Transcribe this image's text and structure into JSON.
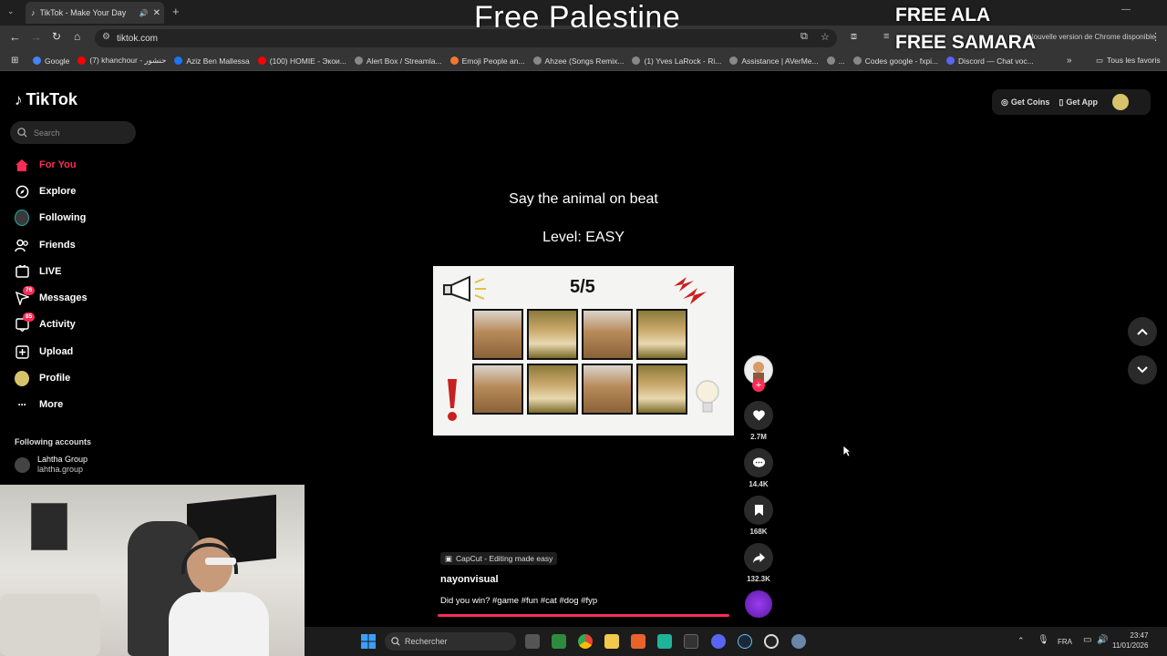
{
  "overlay": {
    "main": "Free Palestine",
    "line1": "FREE ALA",
    "line2": "FREE SAMARA"
  },
  "browser": {
    "tab_title": "TikTok - Make Your Day",
    "url": "tiktok.com",
    "update_notice": "Nouvelle version de Chrome disponible",
    "bookmarks": [
      {
        "label": "Google",
        "color": "#4285f4"
      },
      {
        "label": "(7) khanchour - حنشور",
        "color": "#ff0000"
      },
      {
        "label": "Aziz Ben Mallessa",
        "color": "#1877f2"
      },
      {
        "label": "(100) HOMIE - Экои...",
        "color": "#ff0000"
      },
      {
        "label": "Alert Box / Streamla...",
        "color": "#888888"
      },
      {
        "label": "Emoji People an...",
        "color": "#f27830"
      },
      {
        "label": "Ahzee (Songs Remix...",
        "color": "#888888"
      },
      {
        "label": "(1) Yves LaRock - Ri...",
        "color": "#888888"
      },
      {
        "label": "Assistance | AVerMe...",
        "color": "#888888"
      },
      {
        "label": "...",
        "color": "#888888"
      },
      {
        "label": "Codes google - fxpi...",
        "color": "#888888"
      },
      {
        "label": "Discord — Chat voc...",
        "color": "#5865f2"
      }
    ],
    "bookmarks_more": "»",
    "all_bookmarks": "Tous les favoris"
  },
  "tiktok": {
    "logo": "TikTok",
    "search_placeholder": "Search",
    "nav": [
      {
        "label": "For You",
        "active": true
      },
      {
        "label": "Explore"
      },
      {
        "label": "Following"
      },
      {
        "label": "Friends"
      },
      {
        "label": "LIVE"
      },
      {
        "label": "Messages",
        "badge": "76"
      },
      {
        "label": "Activity",
        "badge": "85"
      },
      {
        "label": "Upload"
      },
      {
        "label": "Profile"
      },
      {
        "label": "More"
      }
    ],
    "following_heading": "Following accounts",
    "account": {
      "name": "Lahtha Group",
      "handle": "lahtha.group"
    },
    "get_coins": "Get Coins",
    "get_app": "Get App",
    "accent": "#fe2c55",
    "video": {
      "title": "Say the animal on beat",
      "level": "Level: EASY",
      "score": "5/5",
      "grid": [
        [
          "cat",
          "dog",
          "cat",
          "dog"
        ],
        [
          "cat",
          "dog",
          "cat",
          "dog"
        ]
      ],
      "capcut": "CapCut - Editing made easy",
      "author": "nayonvisual",
      "caption": "Did you win? #game #fun #cat #dog #fyp"
    },
    "actions": {
      "likes": "2.7M",
      "comments": "14.4K",
      "saves": "168K",
      "shares": "132.3K"
    }
  },
  "taskbar": {
    "search": "Rechercher",
    "lang": "FRA",
    "time": "23:47",
    "date": "11/01/2026"
  }
}
